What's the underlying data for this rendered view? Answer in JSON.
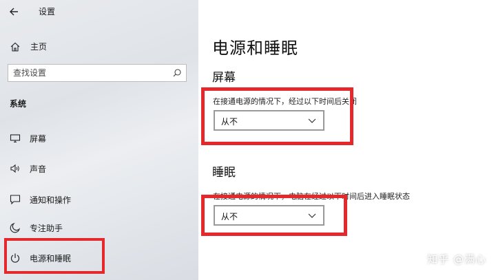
{
  "window": {
    "title": "设置"
  },
  "sidebar": {
    "home_label": "主页",
    "search_placeholder": "查找设置",
    "section_label": "系统",
    "items": [
      {
        "label": "屏幕",
        "icon": "monitor-icon"
      },
      {
        "label": "声音",
        "icon": "speaker-icon"
      },
      {
        "label": "通知和操作",
        "icon": "notification-icon"
      },
      {
        "label": "专注助手",
        "icon": "moon-icon"
      },
      {
        "label": "电源和睡眠",
        "icon": "power-icon",
        "selected": true
      }
    ]
  },
  "main": {
    "title": "电源和睡眠",
    "screen": {
      "heading": "屏幕",
      "description": "在接通电源的情况下，经过以下时间后关闭",
      "value": "从不"
    },
    "sleep": {
      "heading": "睡眠",
      "description": "在接通电源的情况下，电脑在经过以下时间后进入睡眠状态",
      "value": "从不"
    }
  },
  "watermark": "知乎 @满心",
  "colors": {
    "highlight": "#e5282b"
  }
}
